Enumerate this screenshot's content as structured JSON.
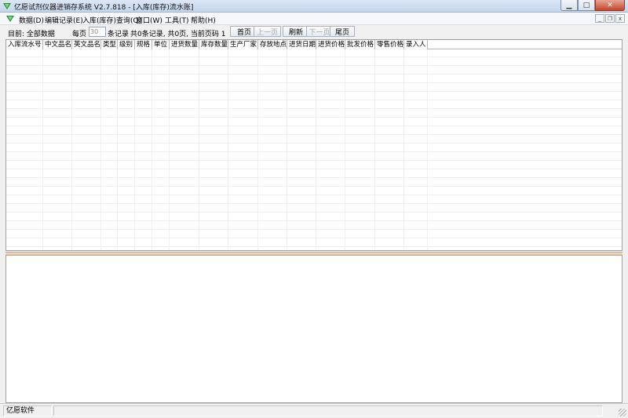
{
  "window": {
    "title": "亿愿试剂仪器进销存系统 V2.7.818 - [入库(库存)流水账]",
    "min_glyph": "▁",
    "max_glyph": "□",
    "close_glyph": "✕"
  },
  "menu": {
    "items": [
      "数据(D)",
      "编辑记录(E)",
      "入库(库存)查询(Q)",
      "窗口(W)",
      "工具(T)",
      "帮助(H)"
    ],
    "mdi_min": "_",
    "mdi_restore": "❐",
    "mdi_close": "x"
  },
  "toolbar": {
    "current_label": "目前: 全部数据",
    "per_page_label": "每页",
    "per_page_value": "30",
    "records_label": "条记录",
    "summary": "共0条记录, 共0页, 当前页码 1",
    "first_label": "首页",
    "prev_label": "上一页",
    "refresh_label": "刷新",
    "next_label": "下一页",
    "last_label": "尾页"
  },
  "grid": {
    "columns": [
      "入库流水号",
      "中文品名",
      "英文品名",
      "类型",
      "级别",
      "规格",
      "单位",
      "进货数量",
      "库存数量",
      "生产厂家",
      "存放地点",
      "进货日期",
      "进货价格",
      "批发价格",
      "零售价格",
      "录入人"
    ]
  },
  "status": {
    "company": "亿愿软件"
  },
  "colors": {
    "splitter": "#e8c39f",
    "titlebar": "#c4d6ec"
  }
}
